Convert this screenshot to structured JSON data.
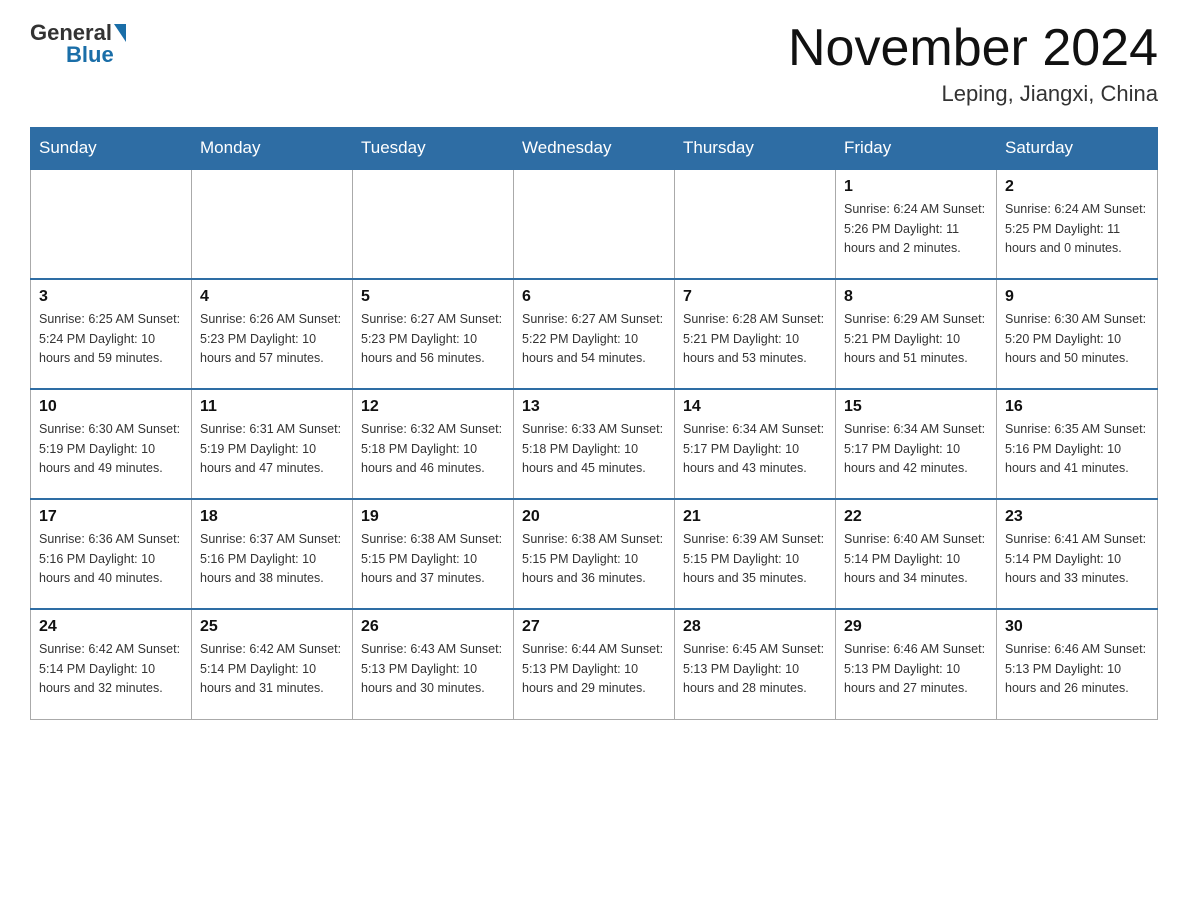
{
  "header": {
    "logo_general": "General",
    "logo_blue": "Blue",
    "month_title": "November 2024",
    "location": "Leping, Jiangxi, China"
  },
  "days_of_week": [
    "Sunday",
    "Monday",
    "Tuesday",
    "Wednesday",
    "Thursday",
    "Friday",
    "Saturday"
  ],
  "weeks": [
    {
      "cells": [
        {
          "day": "",
          "info": ""
        },
        {
          "day": "",
          "info": ""
        },
        {
          "day": "",
          "info": ""
        },
        {
          "day": "",
          "info": ""
        },
        {
          "day": "",
          "info": ""
        },
        {
          "day": "1",
          "info": "Sunrise: 6:24 AM\nSunset: 5:26 PM\nDaylight: 11 hours\nand 2 minutes."
        },
        {
          "day": "2",
          "info": "Sunrise: 6:24 AM\nSunset: 5:25 PM\nDaylight: 11 hours\nand 0 minutes."
        }
      ]
    },
    {
      "cells": [
        {
          "day": "3",
          "info": "Sunrise: 6:25 AM\nSunset: 5:24 PM\nDaylight: 10 hours\nand 59 minutes."
        },
        {
          "day": "4",
          "info": "Sunrise: 6:26 AM\nSunset: 5:23 PM\nDaylight: 10 hours\nand 57 minutes."
        },
        {
          "day": "5",
          "info": "Sunrise: 6:27 AM\nSunset: 5:23 PM\nDaylight: 10 hours\nand 56 minutes."
        },
        {
          "day": "6",
          "info": "Sunrise: 6:27 AM\nSunset: 5:22 PM\nDaylight: 10 hours\nand 54 minutes."
        },
        {
          "day": "7",
          "info": "Sunrise: 6:28 AM\nSunset: 5:21 PM\nDaylight: 10 hours\nand 53 minutes."
        },
        {
          "day": "8",
          "info": "Sunrise: 6:29 AM\nSunset: 5:21 PM\nDaylight: 10 hours\nand 51 minutes."
        },
        {
          "day": "9",
          "info": "Sunrise: 6:30 AM\nSunset: 5:20 PM\nDaylight: 10 hours\nand 50 minutes."
        }
      ]
    },
    {
      "cells": [
        {
          "day": "10",
          "info": "Sunrise: 6:30 AM\nSunset: 5:19 PM\nDaylight: 10 hours\nand 49 minutes."
        },
        {
          "day": "11",
          "info": "Sunrise: 6:31 AM\nSunset: 5:19 PM\nDaylight: 10 hours\nand 47 minutes."
        },
        {
          "day": "12",
          "info": "Sunrise: 6:32 AM\nSunset: 5:18 PM\nDaylight: 10 hours\nand 46 minutes."
        },
        {
          "day": "13",
          "info": "Sunrise: 6:33 AM\nSunset: 5:18 PM\nDaylight: 10 hours\nand 45 minutes."
        },
        {
          "day": "14",
          "info": "Sunrise: 6:34 AM\nSunset: 5:17 PM\nDaylight: 10 hours\nand 43 minutes."
        },
        {
          "day": "15",
          "info": "Sunrise: 6:34 AM\nSunset: 5:17 PM\nDaylight: 10 hours\nand 42 minutes."
        },
        {
          "day": "16",
          "info": "Sunrise: 6:35 AM\nSunset: 5:16 PM\nDaylight: 10 hours\nand 41 minutes."
        }
      ]
    },
    {
      "cells": [
        {
          "day": "17",
          "info": "Sunrise: 6:36 AM\nSunset: 5:16 PM\nDaylight: 10 hours\nand 40 minutes."
        },
        {
          "day": "18",
          "info": "Sunrise: 6:37 AM\nSunset: 5:16 PM\nDaylight: 10 hours\nand 38 minutes."
        },
        {
          "day": "19",
          "info": "Sunrise: 6:38 AM\nSunset: 5:15 PM\nDaylight: 10 hours\nand 37 minutes."
        },
        {
          "day": "20",
          "info": "Sunrise: 6:38 AM\nSunset: 5:15 PM\nDaylight: 10 hours\nand 36 minutes."
        },
        {
          "day": "21",
          "info": "Sunrise: 6:39 AM\nSunset: 5:15 PM\nDaylight: 10 hours\nand 35 minutes."
        },
        {
          "day": "22",
          "info": "Sunrise: 6:40 AM\nSunset: 5:14 PM\nDaylight: 10 hours\nand 34 minutes."
        },
        {
          "day": "23",
          "info": "Sunrise: 6:41 AM\nSunset: 5:14 PM\nDaylight: 10 hours\nand 33 minutes."
        }
      ]
    },
    {
      "cells": [
        {
          "day": "24",
          "info": "Sunrise: 6:42 AM\nSunset: 5:14 PM\nDaylight: 10 hours\nand 32 minutes."
        },
        {
          "day": "25",
          "info": "Sunrise: 6:42 AM\nSunset: 5:14 PM\nDaylight: 10 hours\nand 31 minutes."
        },
        {
          "day": "26",
          "info": "Sunrise: 6:43 AM\nSunset: 5:13 PM\nDaylight: 10 hours\nand 30 minutes."
        },
        {
          "day": "27",
          "info": "Sunrise: 6:44 AM\nSunset: 5:13 PM\nDaylight: 10 hours\nand 29 minutes."
        },
        {
          "day": "28",
          "info": "Sunrise: 6:45 AM\nSunset: 5:13 PM\nDaylight: 10 hours\nand 28 minutes."
        },
        {
          "day": "29",
          "info": "Sunrise: 6:46 AM\nSunset: 5:13 PM\nDaylight: 10 hours\nand 27 minutes."
        },
        {
          "day": "30",
          "info": "Sunrise: 6:46 AM\nSunset: 5:13 PM\nDaylight: 10 hours\nand 26 minutes."
        }
      ]
    }
  ]
}
